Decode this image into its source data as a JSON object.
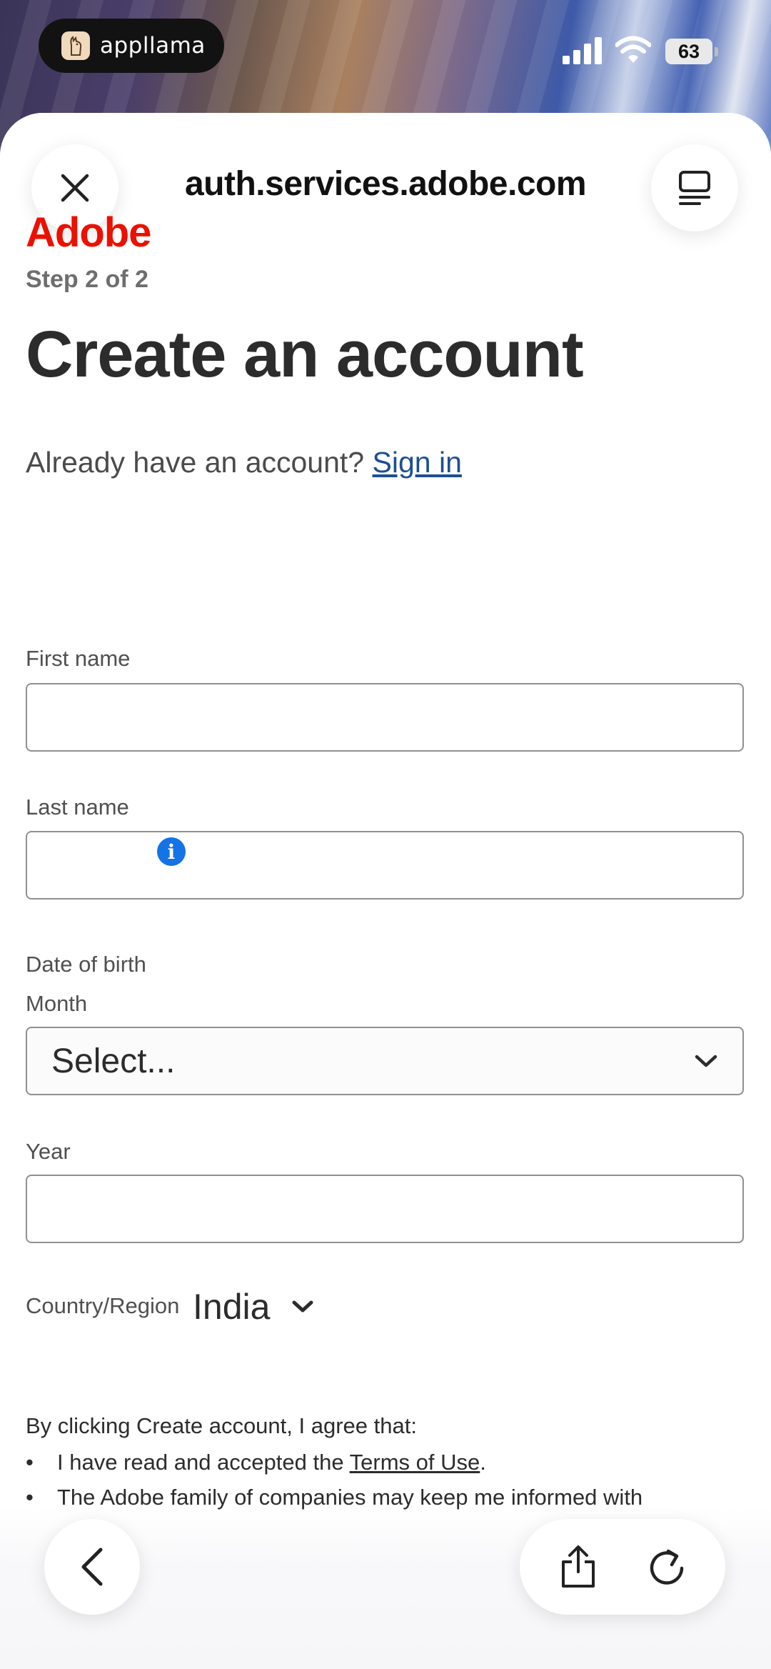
{
  "status_bar": {
    "app_pill_label": "appllama",
    "battery_level": "63"
  },
  "browser": {
    "url": "auth.services.adobe.com"
  },
  "page": {
    "brand": "Adobe",
    "step": "Step 2 of 2",
    "title": "Create an account",
    "already_text": "Already have an account?",
    "sign_in_link": "Sign in",
    "first_name_label": "First name",
    "first_name_value": "",
    "last_name_label": "Last name",
    "last_name_value": "",
    "dob_label": "Date of birth",
    "month_label": "Month",
    "month_value": "Select...",
    "year_label": "Year",
    "year_value": "",
    "country_label": "Country/Region",
    "country_value": "India",
    "terms_intro": "By clicking Create account, I agree that:",
    "bullet_1_prefix": "I have read and accepted the",
    "bullet_1_link": "Terms of Use",
    "bullet_1_suffix": ".",
    "bullet_2": "The Adobe family of companies may keep me informed with"
  },
  "icons": {
    "close": "close-icon",
    "reader": "reader-icon",
    "info": "info-icon",
    "chevron": "chevron-down-icon",
    "back": "back-icon",
    "share": "share-icon",
    "reload": "reload-icon"
  },
  "colors": {
    "brand": "#eb1000",
    "link": "#1d4f91",
    "info": "#1473e6"
  }
}
